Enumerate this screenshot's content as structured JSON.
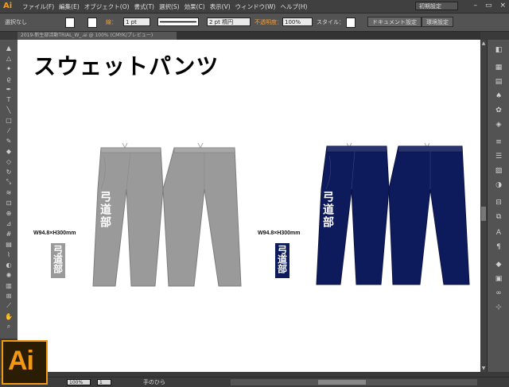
{
  "app": {
    "logo": "Ai"
  },
  "menu": [
    "ファイル(F)",
    "編集(E)",
    "オブジェクト(O)",
    "書式(T)",
    "選択(S)",
    "効果(C)",
    "表示(V)",
    "ウィンドウ(W)",
    "ヘルプ(H)"
  ],
  "workspace": {
    "label": "初期設定"
  },
  "window_controls": {
    "minimize": "–",
    "maximize": "▭",
    "close": "×"
  },
  "control": {
    "selection_label": "選択なし",
    "stroke_label": "線：",
    "stroke_weight": "1 pt",
    "profile_label": "均等",
    "brush_label": "2 pt 楕円",
    "opacity_label": "不透明度：",
    "opacity_value": "100%",
    "style_label": "スタイル：",
    "doc_setup_btn": "ドキュメント設定",
    "env_setup_btn": "環境設定"
  },
  "document_tab": "2019-新生部活動TRIAL_W_.ai @ 100% (CMYK/プレビュー)",
  "canvas": {
    "title": "スウェットパンツ",
    "size_text_1": "W94.8×H300mm",
    "size_text_2": "W94.8×H300mm",
    "vertical_text": "弓道部"
  },
  "colors": {
    "gray_pants": "#9a9a9a",
    "navy_pants": "#0d1a5c",
    "accent": "#f29913"
  },
  "status": {
    "zoom": "100%",
    "page": "1",
    "tool_name": "手のひら"
  },
  "icons": {
    "left": [
      "selection-icon",
      "direct-selection-icon",
      "magic-wand-icon",
      "lasso-icon",
      "pen-icon",
      "type-icon",
      "line-icon",
      "rectangle-icon",
      "paintbrush-icon",
      "pencil-icon",
      "blob-brush-icon",
      "eraser-icon",
      "rotate-icon",
      "scale-icon",
      "warp-icon",
      "free-transform-icon",
      "shape-builder-icon",
      "perspective-icon",
      "mesh-icon",
      "gradient-icon",
      "eyedropper-icon",
      "blend-icon",
      "symbol-sprayer-icon",
      "graph-icon",
      "artboard-icon",
      "slice-icon",
      "hand-icon",
      "zoom-icon"
    ],
    "right": [
      "color-icon",
      "color-guide-icon",
      "swatches-icon",
      "brushes-icon",
      "symbols-icon",
      "graphic-styles-icon",
      "appearance-icon",
      "stroke-icon",
      "gradient-panel-icon",
      "transparency-icon",
      "align-icon",
      "pathfinder-icon",
      "character-icon",
      "paragraph-icon",
      "layers-icon",
      "artboards-icon",
      "links-icon",
      "transform-icon"
    ]
  }
}
